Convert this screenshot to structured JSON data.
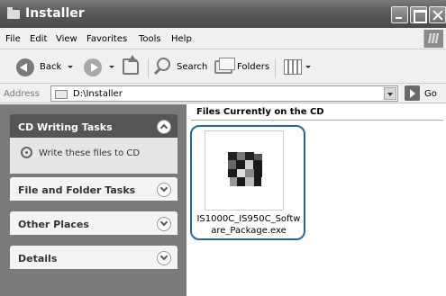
{
  "window": {
    "title": "Installer"
  },
  "menu": {
    "items": [
      "File",
      "Edit",
      "View",
      "Favorites",
      "Tools",
      "Help"
    ]
  },
  "toolbar": {
    "back_label": "Back",
    "search_label": "Search",
    "folders_label": "Folders"
  },
  "address": {
    "label": "Address",
    "value": "D:\\Installer",
    "go_label": "Go"
  },
  "sidebar": {
    "cd_tasks": {
      "title": "CD Writing Tasks",
      "task": "Write these files to CD"
    },
    "file_tasks": {
      "title": "File and Folder Tasks"
    },
    "other_places": {
      "title": "Other Places"
    },
    "details": {
      "title": "Details"
    }
  },
  "content": {
    "group_title": "Files Currently on the CD",
    "file_name_line1": "IS1000C_IS950C_Softw",
    "file_name_line2": "are_Package.exe"
  }
}
